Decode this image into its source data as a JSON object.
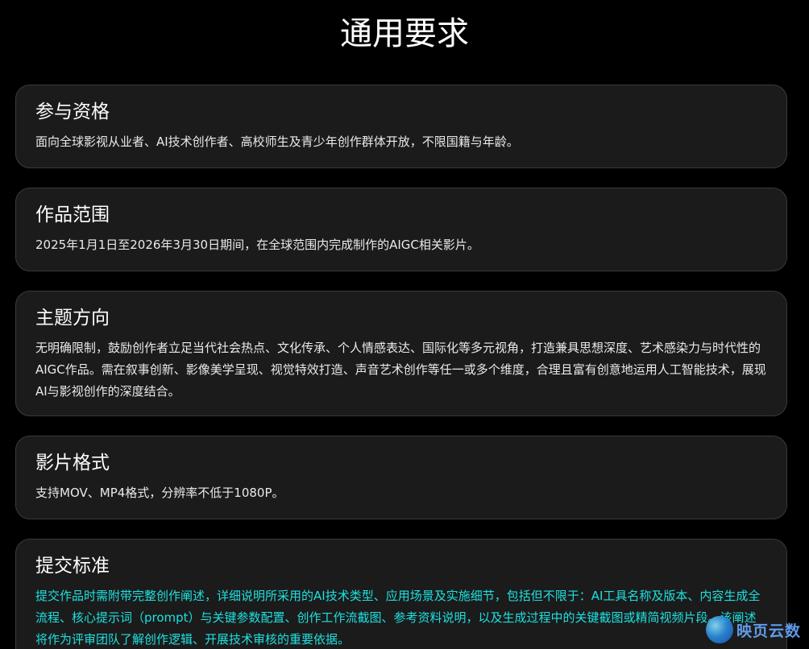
{
  "page": {
    "title": "通用要求"
  },
  "sections": [
    {
      "title": "参与资格",
      "body": "面向全球影视从业者、AI技术创作者、高校师生及青少年创作群体开放，不限国籍与年龄。"
    },
    {
      "title": "作品范围",
      "body": "2025年1月1日至2026年3月30日期间，在全球范围内完成制作的AIGC相关影片。"
    },
    {
      "title": "主题方向",
      "body": "无明确限制，鼓励创作者立足当代社会热点、文化传承、个人情感表达、国际化等多元视角，打造兼具思想深度、艺术感染力与时代性的AIGC作品。需在叙事创新、影像美学呈现、视觉特效打造、声音艺术创作等任一或多个维度，合理且富有创意地运用人工智能技术，展现AI与影视创作的深度结合。"
    },
    {
      "title": "影片格式",
      "body": "支持MOV、MP4格式，分辨率不低于1080P。"
    },
    {
      "title": "提交标准",
      "body": "提交作品时需附带完整创作阐述，详细说明所采用的AI技术类型、应用场景及实施细节，包括但不限于：AI工具名称及版本、内容生成全流程、核心提示词（prompt）与关键参数配置、创作工作流截图、参考资料说明，以及生成过程中的关键截图或精简视频片段。该阐述将作为评审团队了解创作逻辑、开展技术审核的重要依据。"
    }
  ],
  "watermark": {
    "text": "映页云数",
    "icon": "globe-logo-icon"
  },
  "colors": {
    "background": "#000000",
    "card": "#1b1b1b",
    "card_border": "#3a3a3a",
    "text": "#ffffff",
    "highlight": "#1ee0e0"
  }
}
